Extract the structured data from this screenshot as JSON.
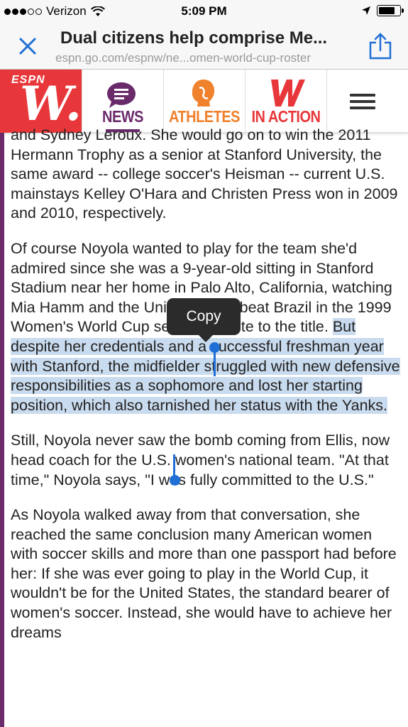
{
  "status_bar": {
    "carrier": "Verizon",
    "time": "5:09 PM",
    "signal_filled": 3,
    "signal_total": 5,
    "battery_level": 0.8
  },
  "browser": {
    "page_title": "Dual citizens help comprise Me...",
    "url": "espn.go.com/espnw/ne...omen-world-cup-roster",
    "close_icon": "close-icon",
    "share_icon": "share-icon"
  },
  "site_nav": {
    "logo_espn": "ESPN",
    "logo_w": "W.",
    "items": [
      {
        "label": "NEWS",
        "icon": "chat-bubble-icon",
        "color": "#6b2b6b",
        "active": true
      },
      {
        "label": "ATHLETES",
        "icon": "athlete-head-icon",
        "color": "#f0812d"
      },
      {
        "label": "IN ACTION",
        "icon": "w-logo-icon",
        "color": "#e8373a"
      }
    ],
    "menu_icon": "hamburger-menu-icon"
  },
  "article": {
    "paragraphs": [
      "and Sydney Leroux. She would go on to win the 2011 Hermann Trophy as a senior at Stanford University, the same award -- college soccer's Heisman -- current U.S. mainstays Kelley O'Hara and Christen Press won in 2009 and 2010, respectively.",
      {
        "before_selection": "Of course Noyola wanted to play for the team she'd admired since she was a 9-year-old sitting in Stanford Stadium near her home in Palo Alto, California, watching Mia Hamm and the United States beat Brazil in the 1999 Women's World Cup semis en route to the title. ",
        "selected": "But despite her credentials and a successful freshman year with Stanford, the midfielder struggled with new defensive responsibilities as a sophomore and lost her starting position, which also tarnished her status with the Yanks."
      },
      "Still, Noyola never saw the bomb coming from Ellis, now head coach for the U.S. women's national team. \"At that time,\" Noyola says, \"I was fully committed to the U.S.\"",
      "As Noyola walked away from that conversation, she reached the same conclusion many American women with soccer skills and more than one passport had before her: If she was ever going to play in the World Cup, it wouldn't be for the United States, the standard bearer of women's soccer. Instead, she would have to achieve her dreams"
    ]
  },
  "context_menu": {
    "copy_label": "Copy"
  },
  "colors": {
    "espnw_red": "#e8373a",
    "news_purple": "#6b2b6b",
    "athletes_orange": "#f0812d",
    "ios_blue": "#1f6fd6",
    "selection": "#c9dbee"
  }
}
